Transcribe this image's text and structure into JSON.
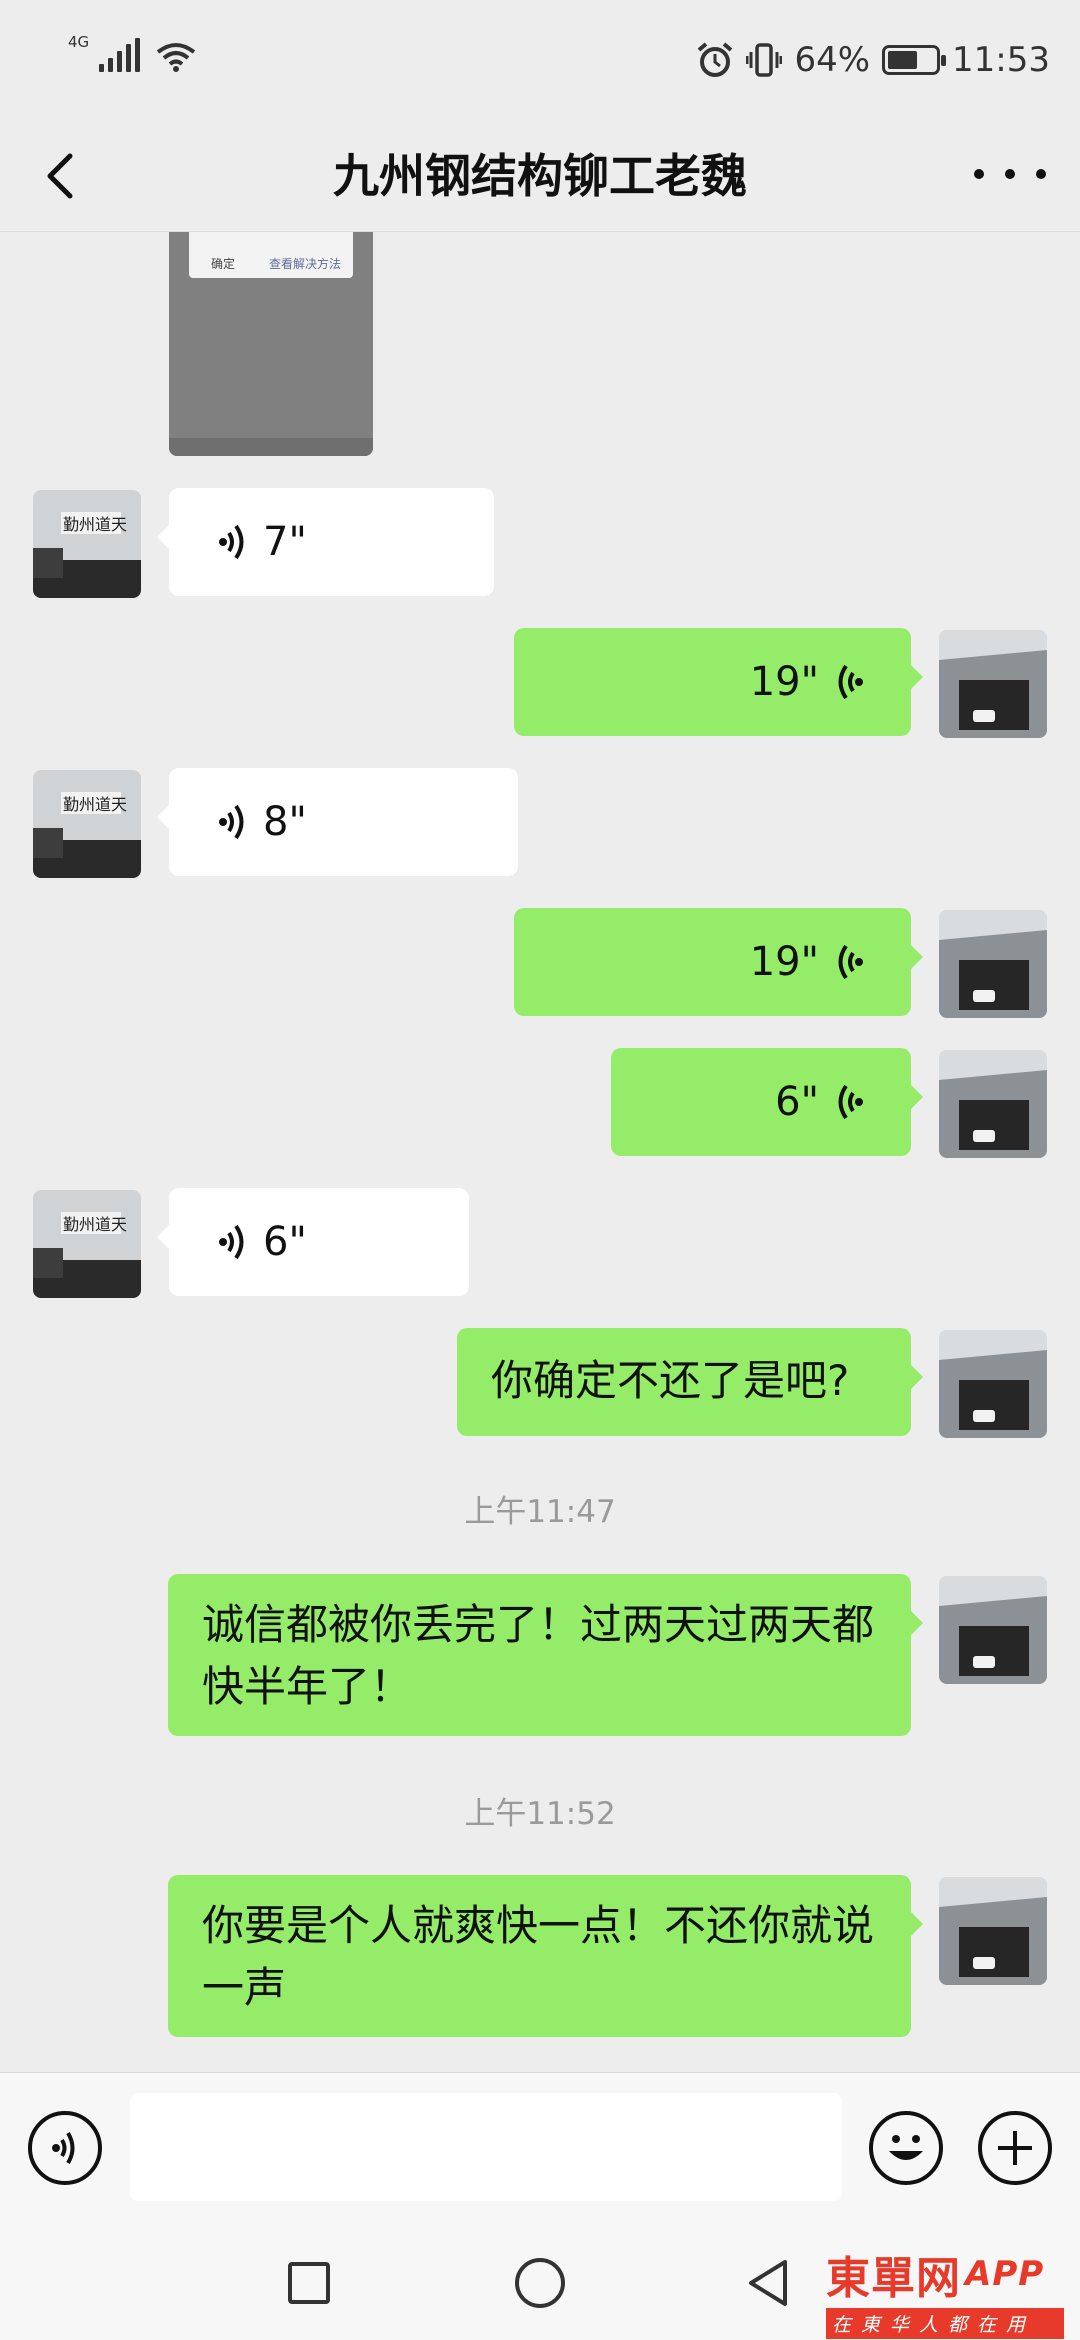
{
  "status_bar": {
    "network": "4G",
    "battery": "64%",
    "battery_level": 0.64,
    "time": "11:53"
  },
  "header": {
    "title": "九州钢结构铆工老魏"
  },
  "image_preview": {
    "left_button": "确定",
    "right_button": "查看解决方法"
  },
  "messages": [
    {
      "from": "contact",
      "type": "voice",
      "duration": "7\""
    },
    {
      "from": "me",
      "type": "voice",
      "duration": "19\""
    },
    {
      "from": "contact",
      "type": "voice",
      "duration": "8\""
    },
    {
      "from": "me",
      "type": "voice",
      "duration": "19\""
    },
    {
      "from": "me",
      "type": "voice",
      "duration": "6\""
    },
    {
      "from": "contact",
      "type": "voice",
      "duration": "6\""
    },
    {
      "from": "me",
      "type": "text",
      "text": "你确定不还了是吧?"
    },
    {
      "type": "time",
      "text": "上午11:47"
    },
    {
      "from": "me",
      "type": "text",
      "text": "诚信都被你丢完了！过两天过两天都快半年了！"
    },
    {
      "type": "time",
      "text": "上午11:52"
    },
    {
      "from": "me",
      "type": "text",
      "text": "你要是个人就爽快一点！不还你就说一声"
    }
  ],
  "input_bar": {
    "placeholder": ""
  },
  "watermark": {
    "brand": "東單网",
    "app": "APP",
    "slogan": "在東华人都在用"
  },
  "colors": {
    "background": "#ededed",
    "sent_bubble": "#95ec69",
    "received_bubble": "#ffffff",
    "watermark": "#e83a2a"
  }
}
